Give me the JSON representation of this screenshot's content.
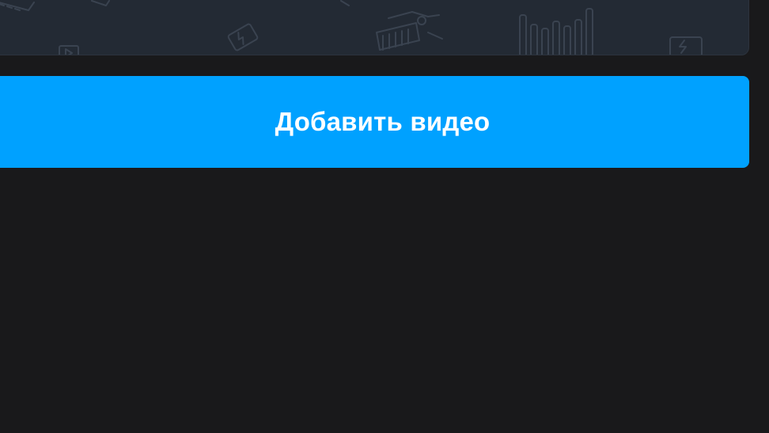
{
  "upload_panel": {
    "background_pattern": "doodle-pattern",
    "icons": [
      "keyboard-icon",
      "battery-icon",
      "film-icon",
      "camera-rig-icon",
      "equalizer-icon",
      "battery-icon"
    ]
  },
  "add_video_button": {
    "label": "Добавить видео",
    "color": "#00a1ff"
  },
  "colors": {
    "background": "#19191b",
    "panel": "#232a34",
    "accent": "#00a1ff"
  }
}
